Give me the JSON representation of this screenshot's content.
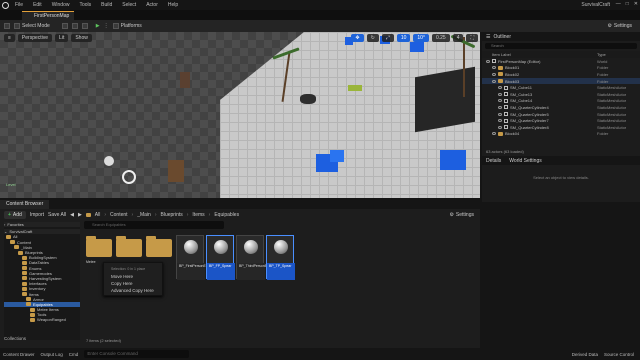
{
  "menubar": {
    "items": [
      "File",
      "Edit",
      "Window",
      "Tools",
      "Build",
      "Select",
      "Actor",
      "Help"
    ],
    "app_title": "SurvivalCraft",
    "win_controls": [
      "—",
      "□",
      "✕"
    ]
  },
  "tabs": {
    "map_tab": "FirstPersonMap"
  },
  "toolbar": {
    "select_mode": "Select Mode",
    "platforms": "Platforms",
    "settings": "Settings"
  },
  "viewport": {
    "perspective": "Perspective",
    "lit": "Lit",
    "show": "Show",
    "snap_grid": "10",
    "snap_angle": "10°",
    "snap_scale": "0.25",
    "cam_speed": "4",
    "corner_label": "Level"
  },
  "outliner": {
    "title": "Outliner",
    "search_placeholder": "Search",
    "col_item": "Item Label",
    "col_type": "Type",
    "rows": [
      {
        "label": "FirstPersonMap (Editor)",
        "type": "World"
      },
      {
        "label": "Block01",
        "type": "Folder"
      },
      {
        "label": "Block02",
        "type": "Folder"
      },
      {
        "label": "Block03",
        "type": "Folder"
      },
      {
        "label": "SM_Cube11",
        "type": "StaticMeshActor"
      },
      {
        "label": "SM_Cube13",
        "type": "StaticMeshActor"
      },
      {
        "label": "SM_Cube14",
        "type": "StaticMeshActor"
      },
      {
        "label": "SM_QuarterCylinder4",
        "type": "StaticMeshActor"
      },
      {
        "label": "SM_QuarterCylinder5",
        "type": "StaticMeshActor"
      },
      {
        "label": "SM_QuarterCylinder7",
        "type": "StaticMeshActor"
      },
      {
        "label": "SM_QuarterCylinder8",
        "type": "StaticMeshActor"
      },
      {
        "label": "Block04",
        "type": "Folder"
      }
    ],
    "footer": "63 actors (63 loaded)"
  },
  "details": {
    "tab_details": "Details",
    "tab_world": "World Settings",
    "empty_text": "Select an object to view details."
  },
  "content_browser": {
    "tab": "Content Browser",
    "add": "Add",
    "import": "Import",
    "save_all": "Save All",
    "breadcrumbs": [
      "All",
      "Content",
      "_Main",
      "Blueprints",
      "Items",
      "Equipables"
    ],
    "settings": "Settings",
    "search_placeholder": "Search Equipables",
    "favorites": "Favorites",
    "project": "SurvivalCraft",
    "tree": [
      "All",
      "Content",
      "_Main",
      "Blueprints",
      "BuildingSystem",
      "DataTables",
      "Enums",
      "Gamemodes",
      "HarvestingSystem",
      "Interfaces",
      "Inventory",
      "Items",
      "Armor",
      "Equipables",
      "Melee Items",
      "Tools",
      "WeaponRanged"
    ],
    "assets": [
      {
        "kind": "folder",
        "label": "Melee"
      },
      {
        "kind": "folder",
        "label": ""
      },
      {
        "kind": "folder",
        "label": ""
      },
      {
        "kind": "bp",
        "label": "BP_FirstPersonEquipable",
        "selected": false
      },
      {
        "kind": "bp",
        "label": "BP_FP_Spear",
        "selected": true
      },
      {
        "kind": "bp",
        "label": "BP_ThirdPersonEquipable",
        "selected": false
      },
      {
        "kind": "bp",
        "label": "BP_TP_Spear",
        "selected": true
      }
    ],
    "status": "7 items (2 selected)",
    "collections": "Collections"
  },
  "context_menu": {
    "header": "Selection: 0 in 1 place",
    "items": [
      "Move Here",
      "Copy Here",
      "Advanced Copy Here"
    ]
  },
  "statusbar": {
    "content_drawer": "Content Drawer",
    "output_log": "Output Log",
    "cmd": "Cmd",
    "cmd_placeholder": "Enter Console Command",
    "derived": "Derived Data",
    "source_control": "Source Control"
  }
}
